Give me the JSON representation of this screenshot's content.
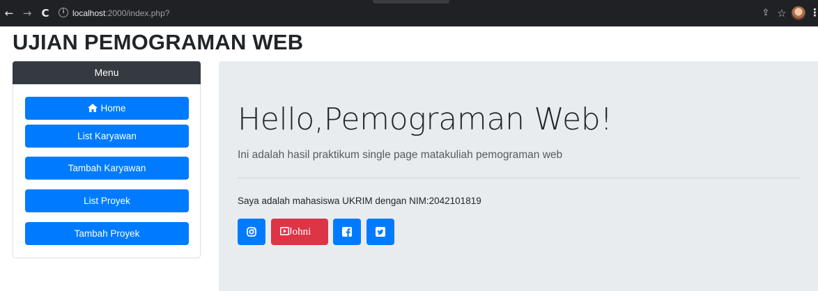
{
  "browser": {
    "back_icon": "←",
    "forward_icon": "→",
    "reload_icon": "C",
    "info_icon": "i",
    "url_host": "localhost",
    "url_rest": ":2000/index.php?",
    "share_icon": "⇪",
    "star_icon": "☆",
    "menu_icon": "⋮"
  },
  "page": {
    "title": "UJIAN PEMOGRAMAN WEB"
  },
  "sidebar": {
    "header": "Menu",
    "items": [
      {
        "label": "Home",
        "icon": "home-icon"
      },
      {
        "label": "List Karyawan"
      },
      {
        "label": "Tambah Karyawan"
      },
      {
        "label": "List Proyek"
      },
      {
        "label": "Tambah Proyek"
      }
    ]
  },
  "jumbotron": {
    "heading": "Hello,Pemograman Web!",
    "lead": "Ini adalah hasil praktikum single page matakuliah pemograman web",
    "text": "Saya adalah mahasiswa UKRIM dengan NIM:2042101819",
    "social": {
      "instagram_icon": "instagram-icon",
      "youtube_label": "Johni",
      "facebook_icon": "facebook-icon",
      "twitter_icon": "twitter-icon"
    }
  },
  "colors": {
    "primary": "#007bff",
    "danger": "#dc3545",
    "dark": "#343a40",
    "jumbotron_bg": "#e9ecef"
  }
}
